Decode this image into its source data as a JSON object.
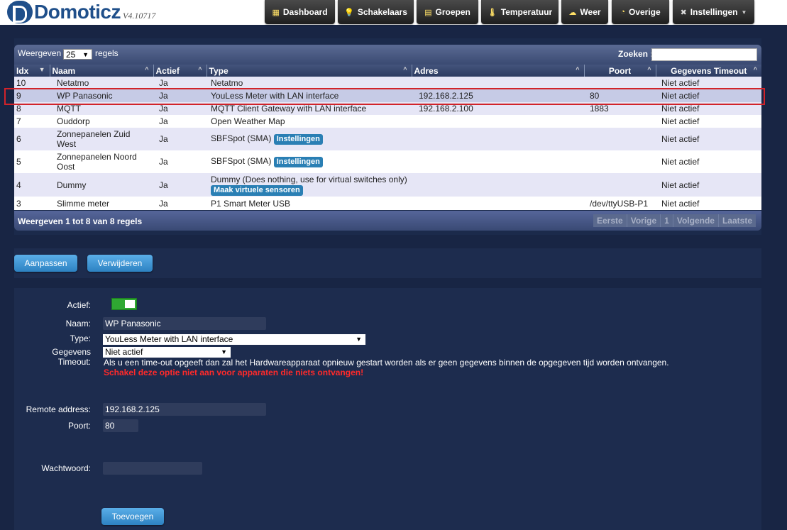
{
  "app": {
    "name": "Domoticz",
    "version": "V4.10717"
  },
  "nav": [
    {
      "label": "Dashboard",
      "icon": "dashboard-icon",
      "glyph": "▦"
    },
    {
      "label": "Schakelaars",
      "icon": "lightbulb-icon",
      "glyph": "💡"
    },
    {
      "label": "Groepen",
      "icon": "groups-icon",
      "glyph": "▤"
    },
    {
      "label": "Temperatuur",
      "icon": "thermometer-icon",
      "glyph": "🌡"
    },
    {
      "label": "Weer",
      "icon": "weather-icon",
      "glyph": "☁"
    },
    {
      "label": "Overige",
      "icon": "utility-icon",
      "glyph": "◔"
    },
    {
      "label": "Instellingen",
      "icon": "tools-icon",
      "glyph": "✖"
    }
  ],
  "table": {
    "show_prefix": "Weergeven",
    "show_suffix": "regels",
    "page_size": "25",
    "search_label": "Zoeken :",
    "columns": [
      "Idx",
      "Naam",
      "Actief",
      "Type",
      "Adres",
      "Poort",
      "Gegevens Timeout"
    ],
    "rows": [
      {
        "idx": "10",
        "name": "Netatmo",
        "active": "Ja",
        "type": "Netatmo",
        "btn": "",
        "address": "",
        "port": "",
        "timeout": "Niet actief"
      },
      {
        "idx": "9",
        "name": "WP Panasonic",
        "active": "Ja",
        "type": "YouLess Meter with LAN interface",
        "btn": "",
        "address": "192.168.2.125",
        "port": "80",
        "timeout": "Niet actief"
      },
      {
        "idx": "8",
        "name": "MQTT",
        "active": "Ja",
        "type": "MQTT Client Gateway with LAN interface",
        "btn": "",
        "address": "192.168.2.100",
        "port": "1883",
        "timeout": "Niet actief"
      },
      {
        "idx": "7",
        "name": "Ouddorp",
        "active": "Ja",
        "type": "Open Weather Map",
        "btn": "",
        "address": "",
        "port": "",
        "timeout": "Niet actief"
      },
      {
        "idx": "6",
        "name": "Zonnepanelen Zuid West",
        "active": "Ja",
        "type": "SBFSpot (SMA)",
        "btn": "Instellingen",
        "address": "",
        "port": "",
        "timeout": "Niet actief"
      },
      {
        "idx": "5",
        "name": "Zonnepanelen Noord Oost",
        "active": "Ja",
        "type": "SBFSpot (SMA)",
        "btn": "Instellingen",
        "address": "",
        "port": "",
        "timeout": "Niet actief"
      },
      {
        "idx": "4",
        "name": "Dummy",
        "active": "Ja",
        "type": "Dummy (Does nothing, use for virtual switches only)",
        "btn": "Maak virtuele sensoren",
        "address": "",
        "port": "",
        "timeout": "Niet actief"
      },
      {
        "idx": "3",
        "name": "Slimme meter",
        "active": "Ja",
        "type": "P1 Smart Meter USB",
        "btn": "",
        "address": "",
        "port": "/dev/ttyUSB-P1",
        "timeout": "Niet actief"
      }
    ],
    "info": "Weergeven 1 tot 8 van 8 regels",
    "pager": [
      "Eerste",
      "Vorige",
      "1",
      "Volgende",
      "Laatste"
    ]
  },
  "actions": {
    "edit": "Aanpassen",
    "delete": "Verwijderen"
  },
  "form": {
    "active_label": "Actief:",
    "name_label": "Naam:",
    "name_value": "WP Panasonic",
    "type_label": "Type:",
    "type_value": "YouLess Meter with LAN interface",
    "timeout_label_1": "Gegevens",
    "timeout_label_2": "Timeout:",
    "timeout_value": "Niet actief",
    "timeout_note": "Als u een time-out opgeeft dan zal het Hardwareapparaat opnieuw gestart worden als er geen gegevens binnen de opgegeven tijd worden ontvangen.",
    "timeout_warning": "Schakel deze optie niet aan voor apparaten die niets ontvangen!",
    "remote_label": "Remote address:",
    "remote_value": "192.168.2.125",
    "port_label": "Poort:",
    "port_value": "80",
    "password_label": "Wachtwoord:",
    "password_value": "",
    "add_button": "Toevoegen"
  },
  "colors": {
    "background": "#182544",
    "accent": "#2d82c2",
    "highlight": "#d2232a",
    "toggle_on": "#2fa832",
    "warning": "#ff2a2a"
  }
}
